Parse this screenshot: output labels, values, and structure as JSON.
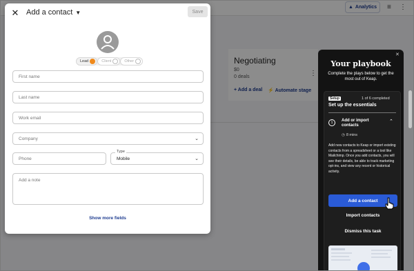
{
  "background": {
    "analytics_label": "Analytics",
    "stage_title": "Negotiating",
    "stage_amount": "$0",
    "stage_deals": "0 deals",
    "add_deal": "+ Add a deal",
    "automate_stage": "Automate stage"
  },
  "modal": {
    "title": "Add a contact",
    "save_label": "Save",
    "contact_types": [
      "Lead",
      "Client",
      "Other"
    ],
    "selected_type": "Lead",
    "fields": {
      "first_name": "First name",
      "last_name": "Last name",
      "work_email": "Work email",
      "company": "Company",
      "phone": "Phone",
      "type_label": "Type",
      "type_value": "Mobile",
      "note": "Add a note"
    },
    "show_more": "Show more fields"
  },
  "playbook": {
    "title": "Your playbook",
    "subtitle": "Complete the plays below to get the most out of Keap.",
    "setup_badge": "Setup",
    "progress": "1 of 6 completed",
    "setup_title": "Set up the essentials",
    "step_number": "1",
    "step_title": "Add or import contacts",
    "step_time": "8 mins",
    "step_description": "Add new contacts to Keap or import existing contacts from a spreadsheet or a tool like Mailchimp. Once you add contacts, you will see their details, be able to track marketing opt-ins, and view any recent or historical activity.",
    "add_contact_button": "Add a contact",
    "import_contacts": "Import contacts",
    "dismiss_task": "Dismiss this task"
  },
  "colors": {
    "accent": "#2a5bd7",
    "lead_dot": "#f08a1c",
    "playbook_bg": "#131313"
  }
}
